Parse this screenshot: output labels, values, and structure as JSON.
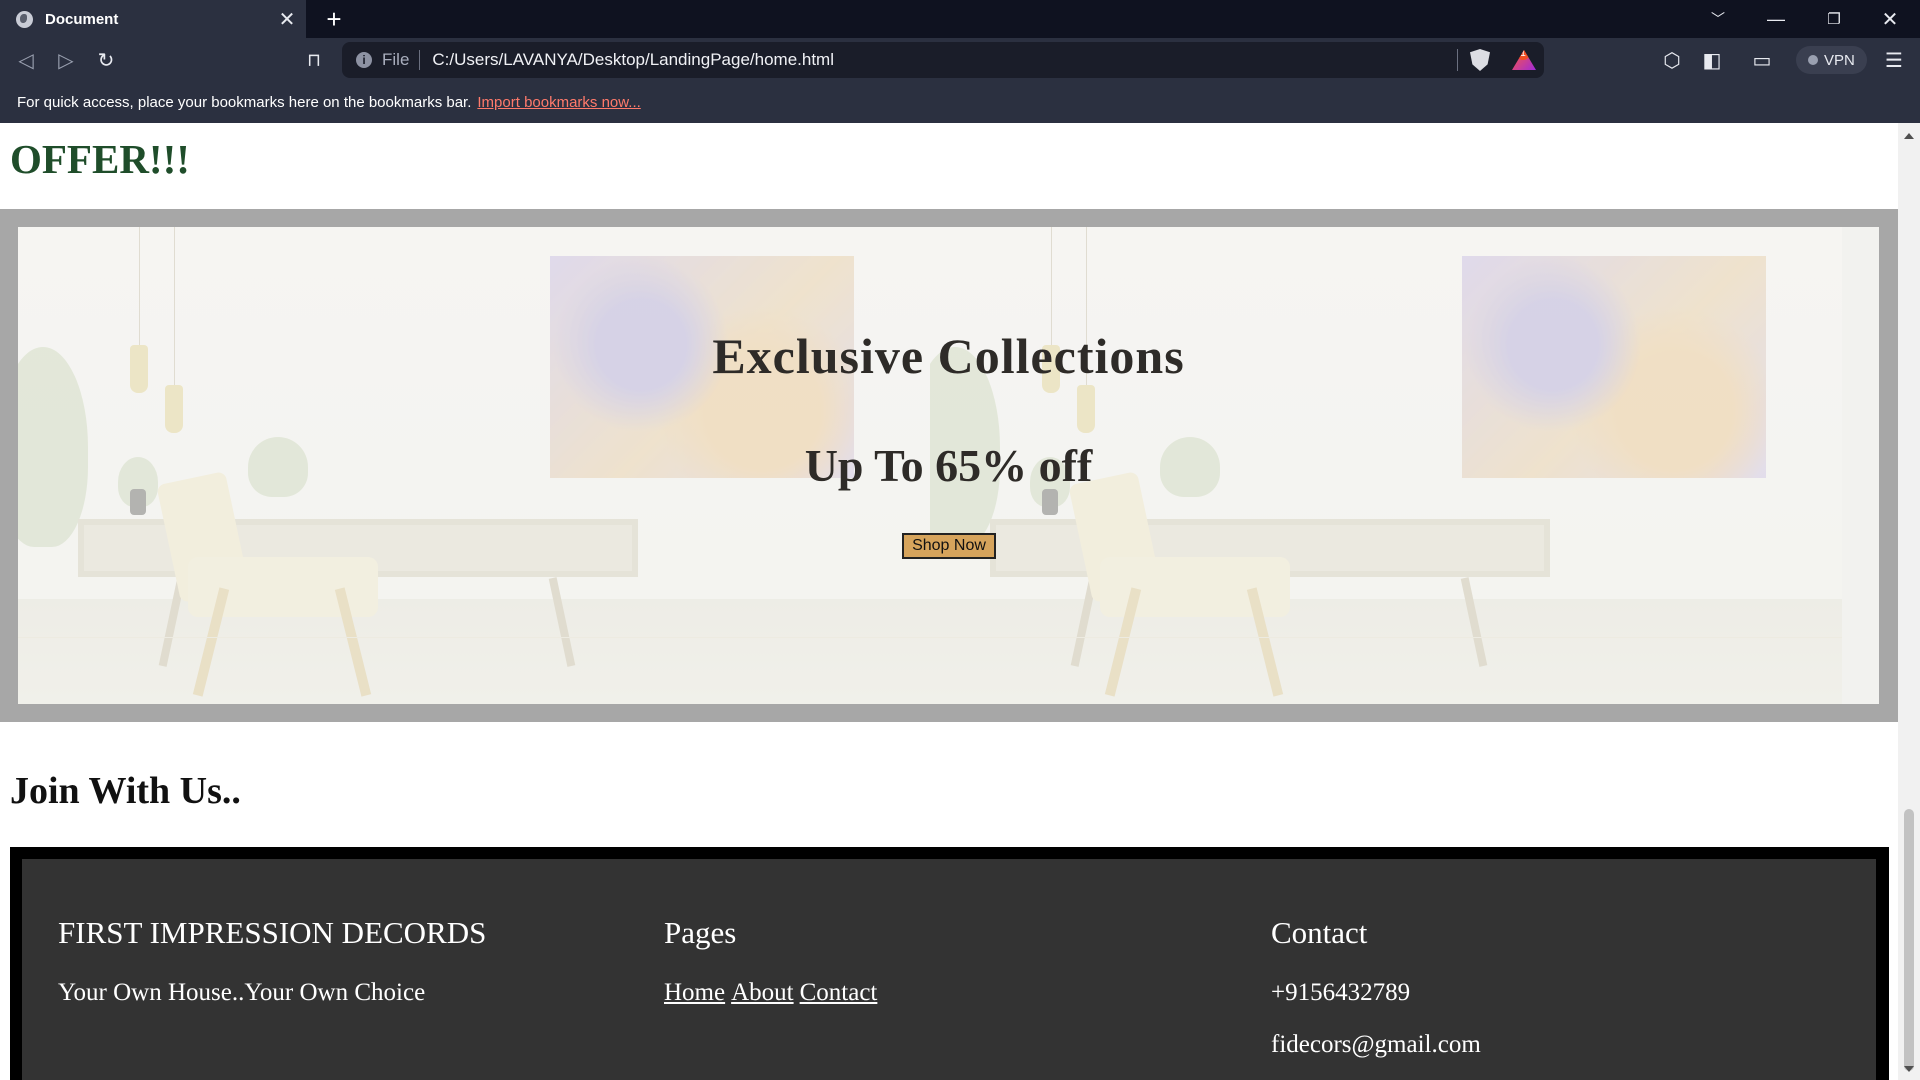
{
  "browser": {
    "tab_title": "Document",
    "tab_close": "✕",
    "new_tab": "+",
    "url_scheme": "File",
    "url": "C:/Users/LAVANYA/Desktop/LandingPage/home.html",
    "rewards_badge": "1",
    "vpn_label": "VPN",
    "bookmarks_message": "For quick access, place your bookmarks here on the bookmarks bar.",
    "bookmarks_import": "Import bookmarks now..."
  },
  "page": {
    "offer_heading": "OFFER!!!",
    "hero": {
      "title": "Exclusive Collections",
      "subtitle": "Up To 65% off",
      "button": "Shop Now"
    },
    "join_heading": "Join With Us..",
    "footer": {
      "brand_title": "FIRST IMPRESSION DECORDS",
      "tagline": "Your Own House..Your Own Choice",
      "pages_title": "Pages",
      "links": [
        "Home",
        "About",
        "Contact"
      ],
      "contact_title": "Contact",
      "phone": "+9156432789",
      "email": "fidecors@gmail.com"
    }
  },
  "colors": {
    "offer_heading": "#1f4d2a",
    "button_bg": "#d6a45c",
    "footer_bg": "#333333",
    "chrome_bg": "#2b3040"
  }
}
